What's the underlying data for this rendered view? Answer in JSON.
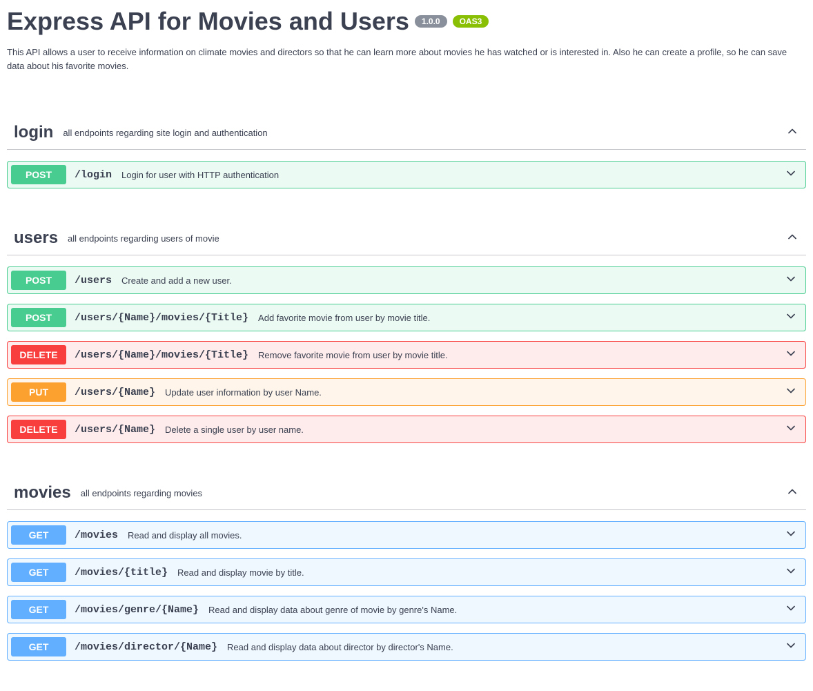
{
  "header": {
    "title": "Express API for Movies and Users",
    "version": "1.0.0",
    "oas": "OAS3",
    "description": "This API allows a user to receive information on climate movies and directors so that he can learn more about movies he has watched or is interested in. Also he can create a profile, so he can save data about his favorite movies."
  },
  "sections": [
    {
      "name": "login",
      "desc": "all endpoints regarding site login and authentication",
      "ops": [
        {
          "method": "POST",
          "methodClass": "op-post",
          "path": "/login",
          "summary": "Login for user with HTTP authentication"
        }
      ]
    },
    {
      "name": "users",
      "desc": "all endpoints regarding users of movie",
      "ops": [
        {
          "method": "POST",
          "methodClass": "op-post",
          "path": "/users",
          "summary": "Create and add a new user."
        },
        {
          "method": "POST",
          "methodClass": "op-post",
          "path": "/users/{Name}/movies/{Title}",
          "summary": "Add favorite movie from user by movie title."
        },
        {
          "method": "DELETE",
          "methodClass": "op-delete",
          "path": "/users/{Name}/movies/{Title}",
          "summary": "Remove favorite movie from user by movie title."
        },
        {
          "method": "PUT",
          "methodClass": "op-put",
          "path": "/users/{Name}",
          "summary": "Update user information by user Name."
        },
        {
          "method": "DELETE",
          "methodClass": "op-delete",
          "path": "/users/{Name}",
          "summary": "Delete a single user by user name."
        }
      ]
    },
    {
      "name": "movies",
      "desc": "all endpoints regarding movies",
      "ops": [
        {
          "method": "GET",
          "methodClass": "op-get",
          "path": "/movies",
          "summary": "Read and display all movies."
        },
        {
          "method": "GET",
          "methodClass": "op-get",
          "path": "/movies/{title}",
          "summary": "Read and display movie by title."
        },
        {
          "method": "GET",
          "methodClass": "op-get",
          "path": "/movies/genre/{Name}",
          "summary": "Read and display data about genre of movie by genre's Name."
        },
        {
          "method": "GET",
          "methodClass": "op-get",
          "path": "/movies/director/{Name}",
          "summary": "Read and display data about director by director's Name."
        }
      ]
    }
  ]
}
